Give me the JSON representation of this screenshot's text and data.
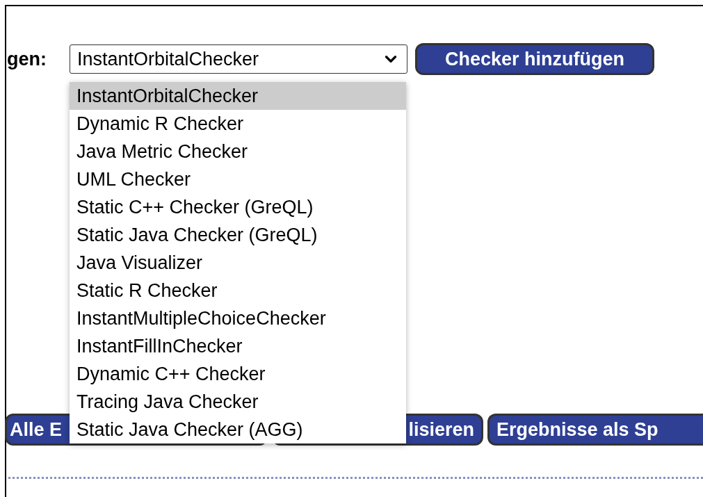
{
  "form": {
    "label": "gen:",
    "select": {
      "value": "InstantOrbitalChecker"
    },
    "add_button": "Checker hinzufügen"
  },
  "dropdown": {
    "options": [
      {
        "label": "InstantOrbitalChecker",
        "selected": true
      },
      {
        "label": "Dynamic R Checker",
        "selected": false
      },
      {
        "label": "Java Metric Checker",
        "selected": false
      },
      {
        "label": "UML Checker",
        "selected": false
      },
      {
        "label": "Static C++ Checker (GreQL)",
        "selected": false
      },
      {
        "label": "Static Java Checker (GreQL)",
        "selected": false
      },
      {
        "label": "Java Visualizer",
        "selected": false
      },
      {
        "label": "Static R Checker",
        "selected": false
      },
      {
        "label": "InstantMultipleChoiceChecker",
        "selected": false
      },
      {
        "label": "InstantFillInChecker",
        "selected": false
      },
      {
        "label": "Dynamic C++ Checker",
        "selected": false
      },
      {
        "label": "Tracing Java Checker",
        "selected": false
      },
      {
        "label": "Static Java Checker (AGG)",
        "selected": false
      }
    ]
  },
  "action_buttons": [
    "Alle E",
    "lisieren",
    "Ergebnisse als Sp"
  ]
}
